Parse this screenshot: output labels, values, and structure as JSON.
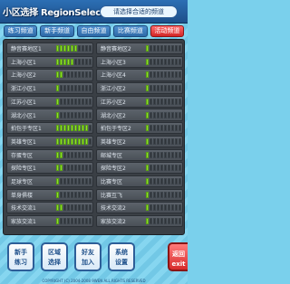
{
  "header": {
    "title": "小区选择 RegionSelection",
    "subtitle": "请选择合适的频道"
  },
  "tabs": [
    {
      "label": "练习频道",
      "active": false
    },
    {
      "label": "新手频道",
      "active": false
    },
    {
      "label": "自由频道",
      "active": false
    },
    {
      "label": "比赛频道",
      "active": false
    },
    {
      "label": "活动频道",
      "active": true
    }
  ],
  "servers": {
    "left": [
      {
        "name": "静音赛地区1",
        "load": 6
      },
      {
        "name": "上海小区1",
        "load": 5
      },
      {
        "name": "上海小区2",
        "load": 2
      },
      {
        "name": "浙江小区1",
        "load": 1
      },
      {
        "name": "江苏小区1",
        "load": 1
      },
      {
        "name": "湖北小区1",
        "load": 1
      },
      {
        "name": "拍包于专区1",
        "load": 9
      },
      {
        "name": "英雄专区1",
        "load": 9
      },
      {
        "name": "存蛋专区",
        "load": 2
      },
      {
        "name": "探险专区1",
        "load": 2
      },
      {
        "name": "足球专区",
        "load": 1
      },
      {
        "name": "单身俱楼",
        "load": 1
      },
      {
        "name": "技术交流1",
        "load": 2
      },
      {
        "name": "家族交流1",
        "load": 1
      }
    ],
    "right": [
      {
        "name": "静音赛地区2",
        "load": 1
      },
      {
        "name": "上海小区3",
        "load": 1
      },
      {
        "name": "上海小区4",
        "load": 1
      },
      {
        "name": "浙江小区2",
        "load": 1
      },
      {
        "name": "江苏小区2",
        "load": 1
      },
      {
        "name": "湖北小区2",
        "load": 1
      },
      {
        "name": "拍包于专区2",
        "load": 1
      },
      {
        "name": "英雄专区2",
        "load": 1
      },
      {
        "name": "邮城专区",
        "load": 1
      },
      {
        "name": "探险专区2",
        "load": 1
      },
      {
        "name": "比赛专区",
        "load": 1
      },
      {
        "name": "比赛互飞",
        "load": 1
      },
      {
        "name": "技术交流2",
        "load": 1
      },
      {
        "name": "家族交流2",
        "load": 1
      }
    ]
  },
  "bottom": {
    "novice_label": "新手\n练习",
    "select_label": "区域\n选择",
    "add_label": "好友\n加入",
    "settings_label": "系统\n设置",
    "back_label": "返回\nexit",
    "footer": "COPYRIGHT (C) 2004-2008 9WEN ALL RIGHTS RESERVED"
  },
  "colors": {
    "header": "#2c6fb4",
    "tab": "#2d6aa8",
    "tab_active": "#d22727",
    "panel": "#3a3f45",
    "load_bar": "#8fdc2f"
  }
}
